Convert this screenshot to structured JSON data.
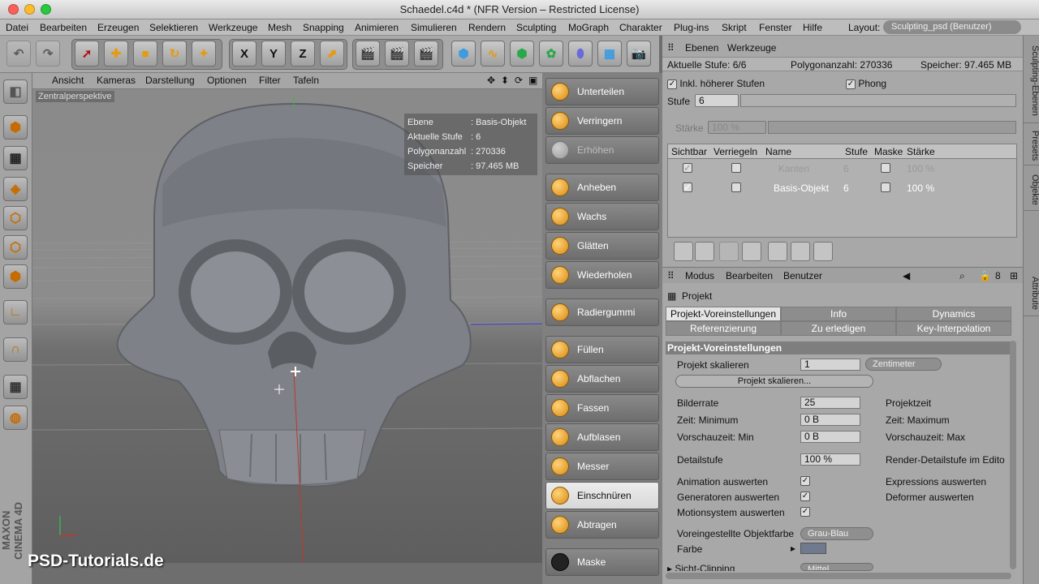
{
  "window": {
    "title": "Schaedel.c4d * (NFR Version – Restricted License)"
  },
  "menu": {
    "items": [
      "Datei",
      "Bearbeiten",
      "Erzeugen",
      "Selektieren",
      "Werkzeuge",
      "Mesh",
      "Snapping",
      "Animieren",
      "Simulieren",
      "Rendern",
      "Sculpting",
      "MoGraph",
      "Charakter",
      "Plug-ins",
      "Skript",
      "Fenster",
      "Hilfe"
    ],
    "layout_label": "Layout:",
    "layout_value": "Sculpting_psd (Benutzer)"
  },
  "viewport": {
    "menu": [
      "Ansicht",
      "Kameras",
      "Darstellung",
      "Optionen",
      "Filter",
      "Tafeln"
    ],
    "perspective": "Zentralperspektive",
    "hud": [
      {
        "k": "Ebene",
        "v": "Basis-Objekt"
      },
      {
        "k": "Aktuelle Stufe",
        "v": "6"
      },
      {
        "k": "Polygonanzahl",
        "v": "270336"
      },
      {
        "k": "Speicher",
        "v": "97.465 MB"
      }
    ]
  },
  "watermark": "PSD-Tutorials.de",
  "brand": "MAXON CINEMA 4D",
  "toolbar": {
    "x": "X",
    "y": "Y",
    "z": "Z"
  },
  "brushes": [
    {
      "label": "Unterteilen",
      "state": "normal"
    },
    {
      "label": "Verringern",
      "state": "normal"
    },
    {
      "label": "Erhöhen",
      "state": "dim"
    },
    {
      "label": "Anheben",
      "state": "normal"
    },
    {
      "label": "Wachs",
      "state": "normal"
    },
    {
      "label": "Glätten",
      "state": "normal"
    },
    {
      "label": "Wiederholen",
      "state": "normal"
    },
    {
      "label": "Radiergummi",
      "state": "normal"
    },
    {
      "label": "Füllen",
      "state": "normal"
    },
    {
      "label": "Abflachen",
      "state": "normal"
    },
    {
      "label": "Fassen",
      "state": "normal"
    },
    {
      "label": "Aufblasen",
      "state": "normal"
    },
    {
      "label": "Messer",
      "state": "normal"
    },
    {
      "label": "Einschnüren",
      "state": "selected"
    },
    {
      "label": "Abtragen",
      "state": "normal"
    },
    {
      "label": "Maske",
      "state": "normal"
    }
  ],
  "layers": {
    "tabs": [
      "Ebenen",
      "Werkzeuge"
    ],
    "info": {
      "stufe": "Aktuelle Stufe:  6/6",
      "polys": "Polygonanzahl: 270336",
      "mem": "Speicher: 97.465 MB"
    },
    "inkl": "Inkl. höherer Stufen",
    "phong": "Phong",
    "stufe_label": "Stufe",
    "stufe_value": "6",
    "staerke_label": "Stärke",
    "staerke_value": "100 %",
    "columns": [
      "Sichtbar",
      "Verriegeln",
      "Name",
      "Stufe",
      "Maske",
      "Stärke"
    ],
    "rows": [
      {
        "name": "Kanten",
        "stufe": "6",
        "staerke": "100 %",
        "dim": true
      },
      {
        "name": "Basis-Objekt",
        "stufe": "6",
        "staerke": "100 %",
        "dim": false
      }
    ]
  },
  "sidetabs": [
    "Sculpting-Ebenen",
    "Presets",
    "Objekte",
    "Attribute"
  ],
  "attributes": {
    "menu": [
      "Modus",
      "Bearbeiten",
      "Benutzer"
    ],
    "object": "Projekt",
    "tabs_row1": [
      "Projekt-Voreinstellungen",
      "Info",
      "Dynamics"
    ],
    "tabs_row2": [
      "Referenzierung",
      "Zu erledigen",
      "Key-Interpolation"
    ],
    "section": "Projekt-Voreinstellungen",
    "skalieren_label": "Projekt skalieren",
    "skalieren_value": "1",
    "unit": "Zentimeter",
    "skalieren_button": "Projekt skalieren...",
    "bilderrate_label": "Bilderrate",
    "bilderrate_value": "25",
    "projektzeit": "Projektzeit",
    "zeitmin_label": "Zeit: Minimum",
    "zeitmin_value": "0 B",
    "zeitmax": "Zeit: Maximum",
    "vorschaumin_label": "Vorschauzeit: Min",
    "vorschaumin_value": "0 B",
    "vorschaumax": "Vorschauzeit: Max",
    "detail_label": "Detailstufe",
    "detail_value": "100 %",
    "renderdetail": "Render-Detailstufe im Edito",
    "anim": "Animation auswerten",
    "expr": "Expressions auswerten",
    "gen": "Generatoren auswerten",
    "deform": "Deformer auswerten",
    "motion": "Motionsystem auswerten",
    "farbe_label": "Voreingestellte Objektfarbe",
    "farbe_value": "Grau-Blau",
    "farbe2": "Farbe",
    "farbe_swatch": "#6f7a8e",
    "clip_label": "Sicht-Clipping",
    "clip_value": "Mittel"
  }
}
